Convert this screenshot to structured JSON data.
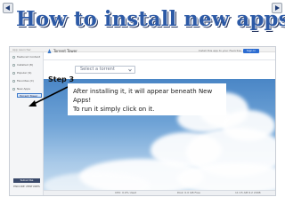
{
  "slide": {
    "title": "How to install new apps",
    "step_label": "Step 3",
    "callout_line1": "After installing it, it will appear beneath New Apps!",
    "callout_line2": "To run it simply click on it."
  },
  "screenshot": {
    "window_title": "App Launcher",
    "sidebar": {
      "items": [
        {
          "label": "Featured Content"
        },
        {
          "label": "Installed (8)"
        },
        {
          "label": "Popular (9)"
        },
        {
          "label": "Favorites (0)"
        },
        {
          "label": "New Apps"
        }
      ],
      "selected_sub_item": "Torrent Tower",
      "badge": "Subscribe",
      "logo_text": "ENCORE VENTURES"
    },
    "header": {
      "app_name": "Torrent Tower",
      "hint": "Install this app to your Favorites",
      "signin_label": "Sign In"
    },
    "select_placeholder": "Select a torrent",
    "status_bar": {
      "left": "CPU: 0.0% Used",
      "middle": "Disk: 0.0 GB Free",
      "right": "11:15 AM 6.2 2008"
    }
  },
  "colors": {
    "title_blue": "#2d5aa6",
    "title_shadow": "#2a3a63",
    "sky_top": "#4a86c6",
    "selection_blue": "#3a78c9",
    "signin_blue": "#2c6cd1"
  },
  "icons": {
    "prev": "arrow-left-icon",
    "next": "arrow-right-icon",
    "app": "tower-icon",
    "dropdown": "chevron-down-icon"
  }
}
